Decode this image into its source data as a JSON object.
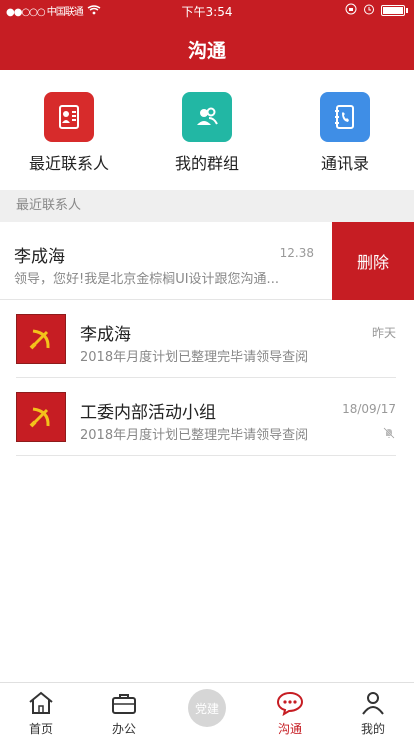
{
  "status_bar": {
    "carrier": "●●○○○ 中国联通",
    "time": "下午3:54"
  },
  "header": {
    "title": "沟通"
  },
  "actions": [
    {
      "label": "最近联系人",
      "icon": "contact-card-icon",
      "color": "#d72b2b"
    },
    {
      "label": "我的群组",
      "icon": "group-icon",
      "color": "#22b7a4"
    },
    {
      "label": "通讯录",
      "icon": "address-book-icon",
      "color": "#3f8ee6"
    }
  ],
  "section": {
    "title": "最近联系人"
  },
  "swiped_row": {
    "name": "李成海",
    "time": "12.38",
    "message": "领导，您好!我是北京金棕榈UI设计跟您沟通...",
    "delete_label": "删除"
  },
  "rows": [
    {
      "name": "李成海",
      "date": "昨天",
      "message": "2018年月度计划已整理完毕请领导查阅",
      "muted": false
    },
    {
      "name": "工委内部活动小组",
      "date": "18/09/17",
      "message": "2018年月度计划已整理完毕请领导查阅",
      "muted": true
    }
  ],
  "tabs": [
    {
      "label": "首页",
      "icon": "home-icon",
      "active": false
    },
    {
      "label": "办公",
      "icon": "briefcase-icon",
      "active": false
    },
    {
      "label": "党建",
      "icon": "party-building-icon",
      "active": false
    },
    {
      "label": "沟通",
      "icon": "chat-icon",
      "active": true
    },
    {
      "label": "我的",
      "icon": "profile-icon",
      "active": false
    }
  ],
  "colors": {
    "accent": "#c61d23",
    "text": "#222222",
    "secondary_text": "#888888"
  }
}
